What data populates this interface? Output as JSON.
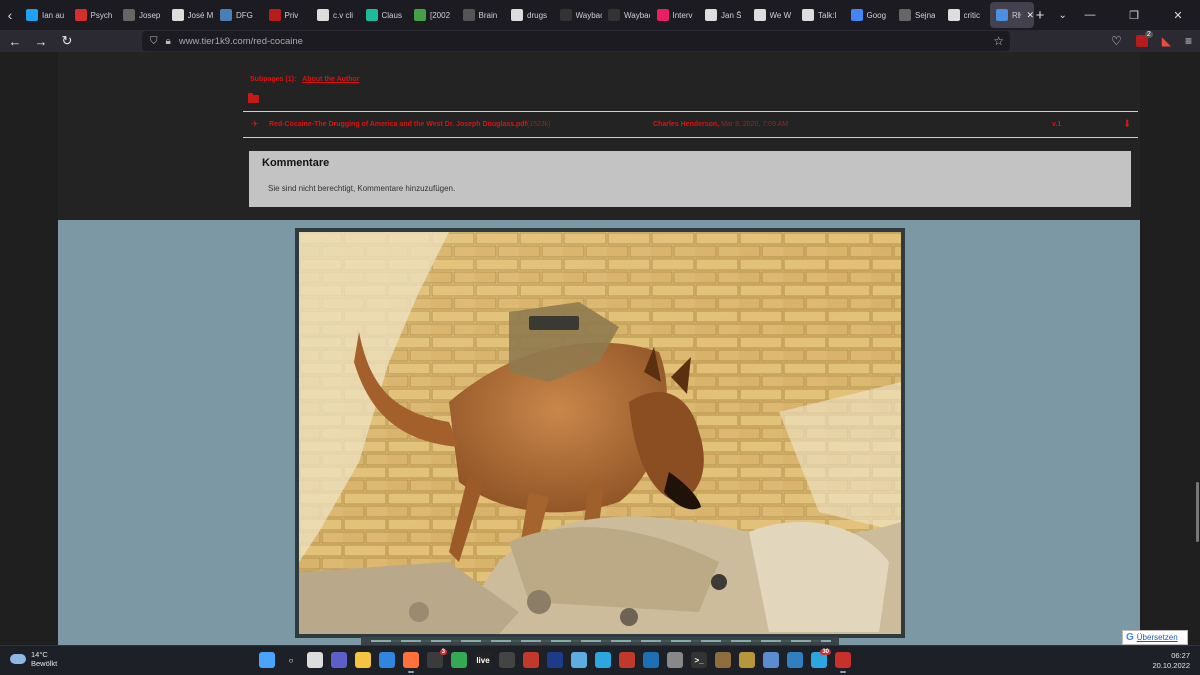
{
  "browser": {
    "tabs": [
      {
        "label": "Ian au",
        "color": "#1da1f2",
        "icon": "twitter-icon"
      },
      {
        "label": "Psych",
        "color": "#d32f2f",
        "icon": "srf-icon"
      },
      {
        "label": "Josep",
        "color": "#666",
        "icon": "link-icon"
      },
      {
        "label": "José M",
        "color": "#ddd",
        "icon": "wikipedia-icon"
      },
      {
        "label": "DFG",
        "color": "#4a7fb5",
        "icon": "dfg-icon"
      },
      {
        "label": "Priv",
        "color": "#b71c1c",
        "icon": "priv-icon"
      },
      {
        "label": "c.v cli",
        "color": "#ddd",
        "icon": "google-icon"
      },
      {
        "label": "Claus",
        "color": "#1abc9c",
        "icon": "rg-icon"
      },
      {
        "label": "[2002",
        "color": "#43a047",
        "icon": "site-icon"
      },
      {
        "label": "Brain",
        "color": "#555",
        "icon": "bookmark-icon"
      },
      {
        "label": "drugs",
        "color": "#ddd",
        "icon": "google-icon"
      },
      {
        "label": "Wayback",
        "color": "#333",
        "icon": "wayback-icon"
      },
      {
        "label": "Wayback",
        "color": "#333",
        "icon": "wayback-icon"
      },
      {
        "label": "Interv",
        "color": "#e91e63",
        "icon": "site-icon"
      },
      {
        "label": "Jan Š",
        "color": "#ddd",
        "icon": "wikipedia-icon"
      },
      {
        "label": "We W",
        "color": "#ddd",
        "icon": "wikipedia-icon"
      },
      {
        "label": "Talk:I",
        "color": "#ddd",
        "icon": "wikipedia-icon"
      },
      {
        "label": "Goog",
        "color": "#4285f4",
        "icon": "translate-icon"
      },
      {
        "label": "Sejna",
        "color": "#666",
        "icon": "document-icon"
      },
      {
        "label": "critic",
        "color": "#ddd",
        "icon": "google-icon"
      },
      {
        "label": "RED",
        "color": "#4a90e2",
        "icon": "site-icon",
        "active": true
      }
    ],
    "url": "www.tier1k9.com/red-cocaine"
  },
  "page": {
    "subpages_label": "Subpages (1):",
    "subpages_link": "About the Author",
    "file": {
      "name": "Red-Cocaine-The Drugging of America and the West Dr. Joseph Douglass.pdf",
      "size": "(1523k)",
      "author": "Charles Henderson,",
      "date": "Mar 8, 2020, 7:09 AM",
      "version": "v.1"
    },
    "comments": {
      "title": "Kommentare",
      "message": "Sie sind nicht berechtigt, Kommentare hinzuzufügen."
    },
    "translate_label": "Übersetzen"
  },
  "taskbar": {
    "weather_temp": "14°C",
    "weather_desc": "Bewölkt",
    "time": "06:27",
    "date": "20.10.2022",
    "apps": [
      {
        "name": "windows-start-icon",
        "color": "#4aa3ff",
        "glyph": ""
      },
      {
        "name": "search-icon",
        "color": "transparent",
        "glyph": "○"
      },
      {
        "name": "task-view-icon",
        "color": "#dddddd",
        "glyph": ""
      },
      {
        "name": "meet-icon",
        "color": "#5b5fc7",
        "glyph": ""
      },
      {
        "name": "file-explorer-icon",
        "color": "#f5c542",
        "glyph": ""
      },
      {
        "name": "defender-icon",
        "color": "#2e86de",
        "glyph": ""
      },
      {
        "name": "firefox-icon",
        "color": "#ff7139",
        "glyph": "",
        "running": true
      },
      {
        "name": "telegram-alt-icon",
        "color": "#3b3b3b",
        "glyph": "",
        "badge": "3"
      },
      {
        "name": "chrome-icon",
        "color": "#34a853",
        "glyph": ""
      },
      {
        "name": "live-icon",
        "color": "#222",
        "glyph": "live"
      },
      {
        "name": "camera-icon",
        "color": "#444",
        "glyph": ""
      },
      {
        "name": "pdf-reader-icon",
        "color": "#c0392b",
        "glyph": ""
      },
      {
        "name": "powershell-icon",
        "color": "#1e3a8a",
        "glyph": ""
      },
      {
        "name": "mail-icon",
        "color": "#5dade2",
        "glyph": ""
      },
      {
        "name": "telegram-icon",
        "color": "#2ca5e0",
        "glyph": ""
      },
      {
        "name": "voice-icon",
        "color": "#c0392b",
        "glyph": ""
      },
      {
        "name": "app-icon",
        "color": "#1f6fb5",
        "glyph": ""
      },
      {
        "name": "vm-icon",
        "color": "#888",
        "glyph": ""
      },
      {
        "name": "terminal-icon",
        "color": "#333",
        "glyph": ">_"
      },
      {
        "name": "books-icon",
        "color": "#8e6e3c",
        "glyph": ""
      },
      {
        "name": "notes-icon",
        "color": "#b8963c",
        "glyph": ""
      },
      {
        "name": "document-icon",
        "color": "#5b8bd0",
        "glyph": ""
      },
      {
        "name": "photos-icon",
        "color": "#2f7fc1",
        "glyph": ""
      },
      {
        "name": "telegram-desktop-icon",
        "color": "#2ca5e0",
        "glyph": "",
        "badge": "30"
      },
      {
        "name": "snip-icon",
        "color": "#c9302c",
        "glyph": "",
        "running": true
      }
    ]
  }
}
